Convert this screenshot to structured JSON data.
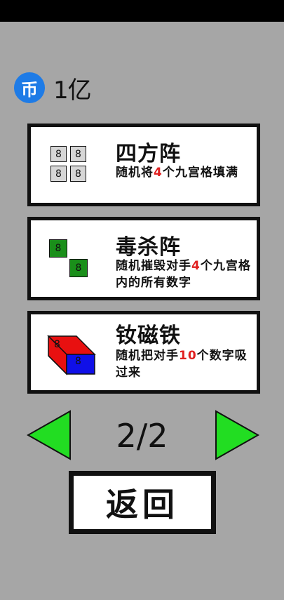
{
  "status_bar": {},
  "currency": {
    "icon": "coin-icon",
    "symbol": "币",
    "amount": "1亿",
    "color": "#1e7be6"
  },
  "items": [
    {
      "title": "四方阵",
      "desc_parts": [
        "随机将",
        "4",
        "个九宫格",
        "填满"
      ],
      "icon": "grid-2x2-icon",
      "cell_digits": [
        "8",
        "8",
        "8",
        "8"
      ]
    },
    {
      "title": "毒杀阵",
      "desc_parts": [
        "随机摧毁对手",
        "4",
        "个九宫格内的所有数字"
      ],
      "icon": "poison-blocks-icon",
      "cell_digits": [
        "8",
        "8"
      ]
    },
    {
      "title": "钕磁铁",
      "desc_parts": [
        "随机把对手",
        "10",
        "个数字吸过来"
      ],
      "icon": "magnet-icon",
      "cell_digits": [
        "8",
        "8"
      ]
    }
  ],
  "pagination": {
    "current": "2/2",
    "prev_icon": "left-arrow-icon",
    "next_icon": "right-arrow-icon"
  },
  "back_button": {
    "label": "返回"
  },
  "colors": {
    "background": "#a6a6a6",
    "arrow": "#22dd22",
    "highlight": "#e02020",
    "magnet_top": "#e81010",
    "magnet_bottom": "#1010e8",
    "poison": "#1a8f1a"
  }
}
